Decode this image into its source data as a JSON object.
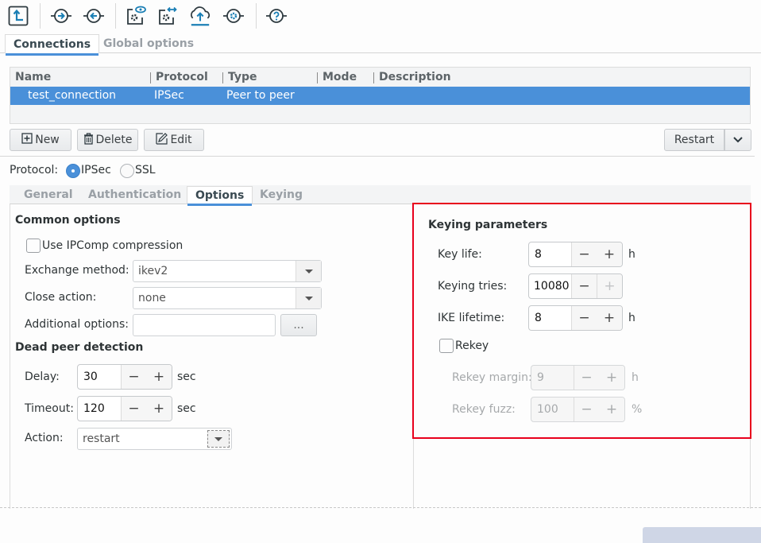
{
  "toolbar": {
    "icons": [
      "import-icon",
      "connect-icon",
      "disconnect-icon",
      "view-config-icon",
      "transfer-config-icon",
      "upload-icon",
      "settings-icon",
      "help-icon"
    ]
  },
  "main_tabs": [
    {
      "label": "Connections",
      "active": true
    },
    {
      "label": "Global options",
      "active": false
    }
  ],
  "table": {
    "columns": [
      "Name",
      "Protocol",
      "Type",
      "Mode",
      "Description"
    ],
    "rows": [
      {
        "name": "test_connection",
        "protocol": "IPSec",
        "type": "Peer to peer",
        "mode": "",
        "description": "",
        "selected": true
      }
    ]
  },
  "actions": {
    "new": "New",
    "delete": "Delete",
    "edit": "Edit",
    "restart": "Restart"
  },
  "protocol": {
    "label": "Protocol:",
    "options": [
      "IPSec",
      "SSL"
    ],
    "selected": "IPSec"
  },
  "sub_tabs": [
    {
      "label": "General",
      "active": false
    },
    {
      "label": "Authentication",
      "active": false
    },
    {
      "label": "Options",
      "active": true
    },
    {
      "label": "Keying",
      "active": false
    }
  ],
  "common_options": {
    "title": "Common options",
    "ipcomp_label": "Use IPComp compression",
    "ipcomp_checked": false,
    "exchange_label": "Exchange method:",
    "exchange_value": "ikev2",
    "close_label": "Close action:",
    "close_value": "none",
    "additional_label": "Additional options:",
    "additional_value": "",
    "browse_label": "..."
  },
  "dpd": {
    "title": "Dead peer detection",
    "delay_label": "Delay:",
    "delay_value": "30",
    "delay_unit": "sec",
    "timeout_label": "Timeout:",
    "timeout_value": "120",
    "timeout_unit": "sec",
    "action_label": "Action:",
    "action_value": "restart"
  },
  "keying": {
    "title": "Keying parameters",
    "keylife_label": "Key life:",
    "keylife_value": "8",
    "keylife_unit": "h",
    "tries_label": "Keying tries:",
    "tries_value": "10080",
    "ike_label": "IKE lifetime:",
    "ike_value": "8",
    "ike_unit": "h",
    "rekey_label": "Rekey",
    "rekey_checked": false,
    "margin_label": "Rekey margin:",
    "margin_value": "9",
    "margin_unit": "h",
    "fuzz_label": "Rekey fuzz:",
    "fuzz_value": "100",
    "fuzz_unit": "%"
  },
  "spin": {
    "minus": "−",
    "plus": "+"
  },
  "colors": {
    "accent": "#4a90d9",
    "highlight_box": "#e8001c",
    "selection": "#4a90d9"
  }
}
